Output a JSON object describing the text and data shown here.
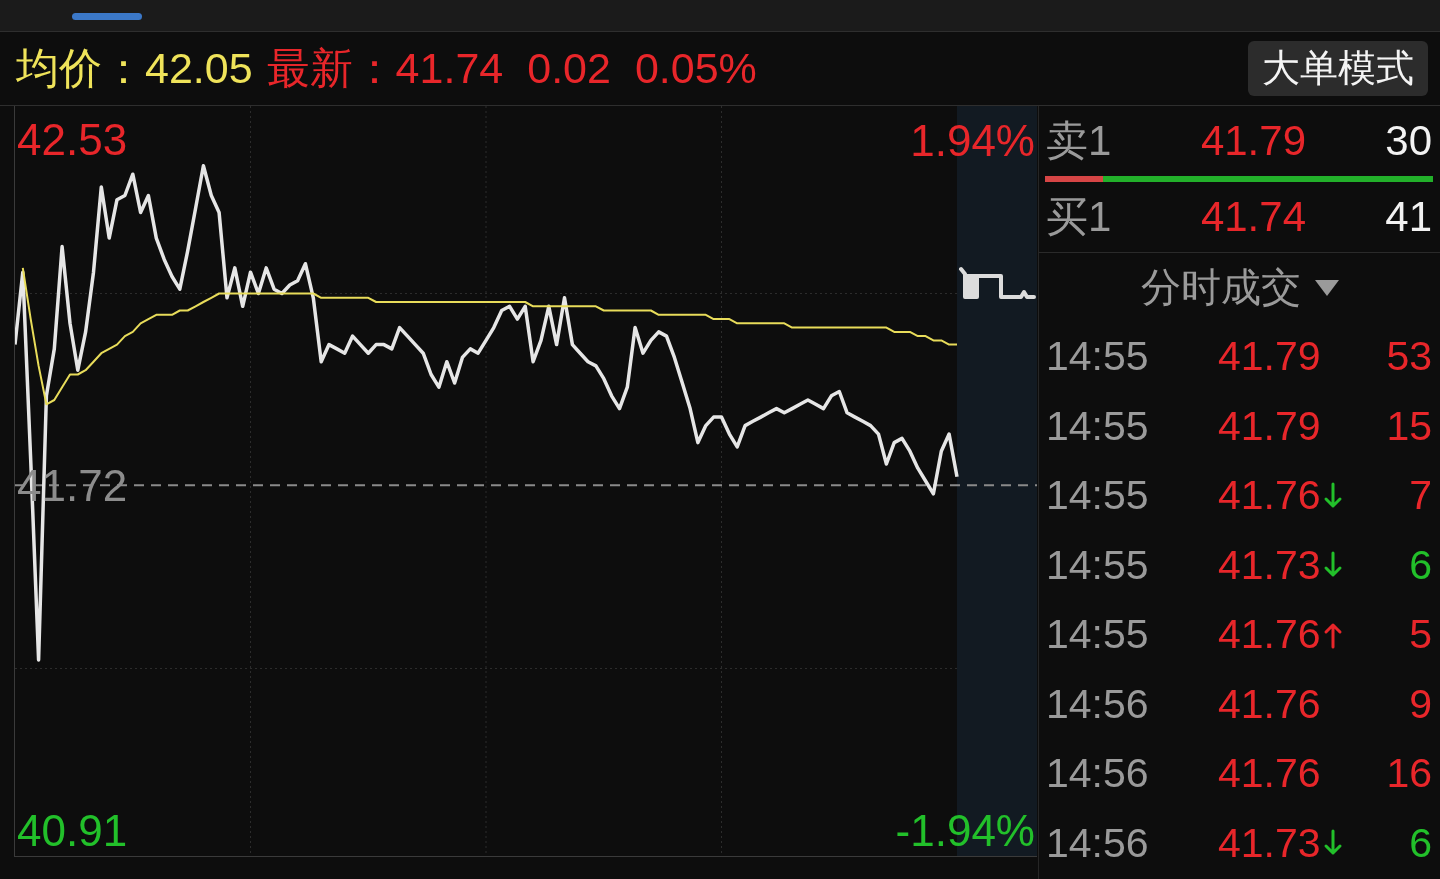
{
  "header": {
    "avg_label": "均价：",
    "avg_value": "42.05",
    "latest_label": "最新：",
    "latest_value": "41.74",
    "change": "0.02",
    "change_pct": "0.05%",
    "mode_button": "大单模式"
  },
  "chart": {
    "upper_pct": "1.94%",
    "lower_pct": "-1.94%",
    "chart_data": [
      {
        "type": "line",
        "tick_labels": "y",
        "ylim": [
          40.85,
          42.61
        ],
        "yticks": [
          {
            "value": 42.53,
            "label": "42.53"
          },
          {
            "value": 41.72,
            "label": "41.72"
          },
          {
            "value": 40.91,
            "label": "40.91"
          }
        ],
        "grid": true,
        "ref_lines": [
          {
            "axis": "y",
            "value": 41.72,
            "color": "#8a8a8a",
            "line_style": "dashed"
          }
        ],
        "categories": [
          null,
          null,
          null,
          null,
          null,
          null,
          null,
          null,
          null,
          null,
          null,
          null,
          null,
          null,
          null,
          null,
          null,
          null,
          null,
          null,
          null,
          null,
          null,
          null,
          null,
          null,
          null,
          null,
          null,
          null,
          null,
          null,
          null,
          null,
          null,
          null,
          null,
          null,
          null,
          null,
          null,
          null,
          null,
          null,
          null,
          null,
          null,
          null,
          null,
          null,
          null,
          null,
          null,
          null,
          null,
          null,
          null,
          null,
          null,
          null,
          null,
          null,
          null,
          null,
          null,
          null,
          null,
          null,
          null,
          null,
          null,
          null,
          null,
          null,
          null,
          null,
          null,
          null,
          null,
          null,
          null,
          null,
          null,
          null,
          null,
          null,
          null,
          null,
          null,
          null,
          null,
          null,
          null,
          null,
          null,
          null,
          null,
          null,
          null,
          null,
          null,
          null,
          null,
          null,
          null,
          null,
          null,
          null,
          null,
          null,
          null,
          null,
          null,
          null,
          null,
          null,
          null,
          null,
          null,
          null,
          null
        ],
        "series": [
          {
            "color": "#e6e6e6",
            "values": [
              42.05,
              42.22,
              41.78,
              41.31,
              41.93,
              42.04,
              42.28,
              42.1,
              41.99,
              42.08,
              42.22,
              42.42,
              42.3,
              42.39,
              42.4,
              42.45,
              42.36,
              42.4,
              42.3,
              42.25,
              42.21,
              42.18,
              42.27,
              42.37,
              42.47,
              42.4,
              42.36,
              42.16,
              42.23,
              42.14,
              42.22,
              42.17,
              42.23,
              42.18,
              42.17,
              42.19,
              42.2,
              42.24,
              42.16,
              42.01,
              42.05,
              42.04,
              42.03,
              42.07,
              42.05,
              42.03,
              42.05,
              42.05,
              42.04,
              42.09,
              42.07,
              42.05,
              42.03,
              41.98,
              41.95,
              42.01,
              41.96,
              42.02,
              42.04,
              42.03,
              42.06,
              42.09,
              42.13,
              42.14,
              42.11,
              42.14,
              42.01,
              42.06,
              42.14,
              42.05,
              42.16,
              42.05,
              42.03,
              42.01,
              42.0,
              41.97,
              41.93,
              41.9,
              41.95,
              42.09,
              42.03,
              42.06,
              42.08,
              42.07,
              42.02,
              41.96,
              41.9,
              41.82,
              41.86,
              41.88,
              41.88,
              41.84,
              41.81,
              41.86,
              41.87,
              41.88,
              41.89,
              41.9,
              41.89,
              41.9,
              41.91,
              41.92,
              41.91,
              41.9,
              41.93,
              41.94,
              41.89,
              41.88,
              41.87,
              41.86,
              41.84,
              41.77,
              41.82,
              41.83,
              41.8,
              41.76,
              41.73,
              41.7,
              41.8,
              41.84,
              41.74
            ]
          },
          {
            "color": "#e8dc5a",
            "values": [
              null,
              42.23,
              42.11,
              42.0,
              41.91,
              41.92,
              41.95,
              41.98,
              41.98,
              41.99,
              42.01,
              42.03,
              42.04,
              42.05,
              42.07,
              42.08,
              42.1,
              42.11,
              42.12,
              42.12,
              42.12,
              42.13,
              42.13,
              42.14,
              42.15,
              42.16,
              42.17,
              42.17,
              42.17,
              42.17,
              42.17,
              42.17,
              42.17,
              42.17,
              42.17,
              42.17,
              42.17,
              42.17,
              42.17,
              42.16,
              42.16,
              42.16,
              42.16,
              42.16,
              42.16,
              42.16,
              42.15,
              42.15,
              42.15,
              42.15,
              42.15,
              42.15,
              42.15,
              42.15,
              42.15,
              42.15,
              42.15,
              42.15,
              42.15,
              42.15,
              42.15,
              42.15,
              42.15,
              42.15,
              42.15,
              42.15,
              42.14,
              42.14,
              42.14,
              42.14,
              42.14,
              42.14,
              42.14,
              42.14,
              42.14,
              42.13,
              42.13,
              42.13,
              42.13,
              42.13,
              42.13,
              42.13,
              42.12,
              42.12,
              42.12,
              42.12,
              42.12,
              42.12,
              42.12,
              42.11,
              42.11,
              42.11,
              42.1,
              42.1,
              42.1,
              42.1,
              42.1,
              42.1,
              42.1,
              42.09,
              42.09,
              42.09,
              42.09,
              42.09,
              42.09,
              42.09,
              42.09,
              42.09,
              42.09,
              42.09,
              42.09,
              42.09,
              42.08,
              42.08,
              42.08,
              42.07,
              42.07,
              42.06,
              42.06,
              42.05,
              42.05
            ]
          }
        ]
      }
    ]
  },
  "order_book": {
    "asks": [
      {
        "label": "卖1",
        "price": "41.79",
        "volume": "30"
      }
    ],
    "ratio_bar": {
      "level": 0.15
    },
    "bids": [
      {
        "label": "买1",
        "price": "41.74",
        "volume": "41"
      }
    ]
  },
  "trades": {
    "title": "分时成交",
    "rows": [
      {
        "time": "14:55",
        "price": "41.79",
        "kind": "plain",
        "volume": "53",
        "color": "#e8262a"
      },
      {
        "time": "14:55",
        "price": "41.79",
        "kind": "plain",
        "volume": "15",
        "color": "#e8262a"
      },
      {
        "time": "14:55",
        "price": "41.76",
        "kind": "down",
        "volume": "7",
        "color": "#e8262a"
      },
      {
        "time": "14:55",
        "price": "41.73",
        "kind": "down",
        "volume": "6",
        "color": "#22c02a"
      },
      {
        "time": "14:55",
        "price": "41.76",
        "kind": "up",
        "volume": "5",
        "color": "#e8262a"
      },
      {
        "time": "14:56",
        "price": "41.76",
        "kind": "plain",
        "volume": "9",
        "color": "#e8262a"
      },
      {
        "time": "14:56",
        "price": "41.76",
        "kind": "plain",
        "volume": "16",
        "color": "#e8262a"
      },
      {
        "time": "14:56",
        "price": "41.73",
        "kind": "down",
        "volume": "6",
        "color": "#22c02a"
      }
    ]
  }
}
